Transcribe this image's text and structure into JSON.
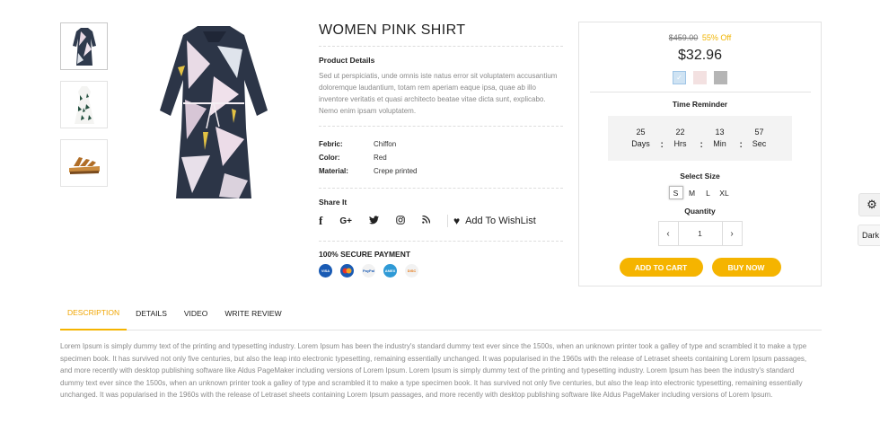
{
  "product": {
    "title": "WOMEN PINK SHIRT",
    "details_heading": "Product Details",
    "description": "Sed ut perspiciatis, unde omnis iste natus error sit voluptatem accusantium doloremque laudantium, totam rem aperiam eaque ipsa, quae ab illo inventore veritatis et quasi architecto beatae vitae dicta sunt, explicabo. Nemo enim ipsam voluptatem.",
    "attributes": [
      {
        "key": "Febric:",
        "value": "Chiffon"
      },
      {
        "key": "Color:",
        "value": "Red"
      },
      {
        "key": "Material:",
        "value": "Crepe printed"
      }
    ],
    "share_heading": "Share It",
    "share_icons": [
      "facebook-icon",
      "google-plus-icon",
      "twitter-icon",
      "instagram-icon",
      "rss-icon"
    ],
    "wishlist_label": "Add To WishList",
    "payment_heading": "100% SECURE PAYMENT",
    "payment_methods": [
      "visa",
      "mastercard",
      "paypal",
      "american-express",
      "discover"
    ]
  },
  "buybox": {
    "old_price": "$459.00",
    "discount": "55% Off",
    "price": "$32.96",
    "swatch_colors": [
      "#cfe3f3",
      "#f3e1e1",
      "#b5b5b5"
    ],
    "timer_label": "Time Reminder",
    "timer": [
      {
        "value": "25",
        "unit": "Days"
      },
      {
        "value": "22",
        "unit": "Hrs"
      },
      {
        "value": "13",
        "unit": "Min"
      },
      {
        "value": "57",
        "unit": "Sec"
      }
    ],
    "size_label": "Select Size",
    "sizes": [
      "S",
      "M",
      "L",
      "XL"
    ],
    "selected_size": "S",
    "quantity_label": "Quantity",
    "quantity": "1",
    "add_to_cart": "ADD TO CART",
    "buy_now": "BUY NOW"
  },
  "side": {
    "dark_label": "Dark"
  },
  "tabs": [
    {
      "label": "DESCRIPTION",
      "active": true
    },
    {
      "label": "DETAILS",
      "active": false
    },
    {
      "label": "VIDEO",
      "active": false
    },
    {
      "label": "WRITE REVIEW",
      "active": false
    }
  ],
  "long_description": "Lorem Ipsum is simply dummy text of the printing and typesetting industry. Lorem Ipsum has been the industry's standard dummy text ever since the 1500s, when an unknown printer took a galley of type and scrambled it to make a type specimen book. It has survived not only five centuries, but also the leap into electronic typesetting, remaining essentially unchanged. It was popularised in the 1960s with the release of Letraset sheets containing Lorem Ipsum passages, and more recently with desktop publishing software like Aldus PageMaker including versions of Lorem Ipsum. Lorem Ipsum is simply dummy text of the printing and typesetting industry. Lorem Ipsum has been the industry's standard dummy text ever since the 1500s, when an unknown printer took a galley of type and scrambled it to make a type specimen book. It has survived not only five centuries, but also the leap into electronic typesetting, remaining essentially unchanged. It was popularised in the 1960s with the release of Letraset sheets containing Lorem Ipsum passages, and more recently with desktop publishing software like Aldus PageMaker including versions of Lorem Ipsum."
}
